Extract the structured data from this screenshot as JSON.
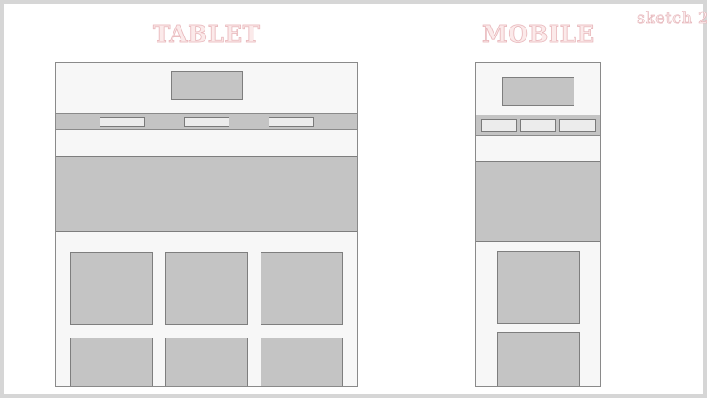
{
  "headings": {
    "tablet": "TABLET",
    "mobile": "MOBILE",
    "sketch": "sketch 2"
  },
  "colors": {
    "heading_fill": "#fbeaea",
    "heading_outline": "#e8b8bc",
    "placeholder_fill": "#c4c4c4",
    "device_background": "#f7f7f7",
    "button_fill": "#ececec"
  },
  "layouts": {
    "tablet": {
      "nav_button_count": 3,
      "content_card_count": 6,
      "content_card_columns": 3
    },
    "mobile": {
      "nav_button_count": 3,
      "content_card_count": 2,
      "content_card_columns": 1
    }
  }
}
